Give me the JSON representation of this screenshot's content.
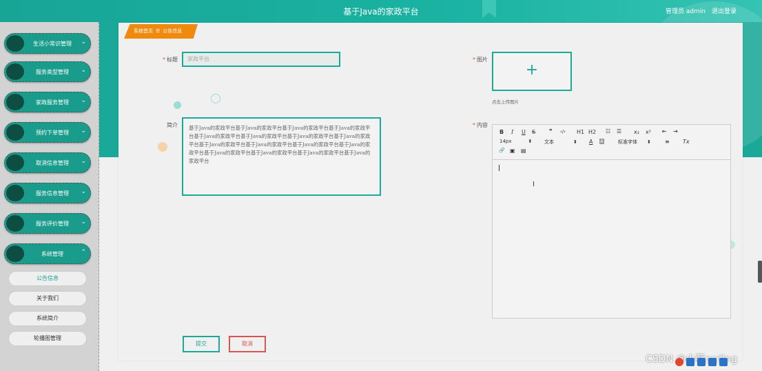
{
  "header": {
    "app_title": "基于Java的家政平台",
    "user_text": "管理员 admin",
    "logout_label": "退出登录"
  },
  "sidebar": {
    "items": [
      {
        "label": "生活小常识管理"
      },
      {
        "label": "服务类型管理"
      },
      {
        "label": "家政服务管理"
      },
      {
        "label": "预约下单管理"
      },
      {
        "label": "取消信息管理"
      },
      {
        "label": "服务信息管理"
      },
      {
        "label": "服务评价管理"
      },
      {
        "label": "系统管理"
      }
    ],
    "sub_items": [
      {
        "label": "公告信息"
      },
      {
        "label": "关于我们"
      },
      {
        "label": "系统简介"
      },
      {
        "label": "轮播图管理"
      }
    ]
  },
  "breadcrumb": {
    "home": "系统首页",
    "separator": "☰",
    "current": "公告信息"
  },
  "form": {
    "title_label": "标题",
    "title_value": "家政平台",
    "intro_label": "简介",
    "intro_value": "基于Java的家政平台基于Java的家政平台基于Java的家政平台基于Java的家政平台基于Java的家政平台基于Java的家政平台基于Java的家政平台基于Java的家政平台基于Java的家政平台基于Java的家政平台基于Java的家政平台基于Java的家政平台基于Java的家政平台基于Java的家政平台基于Java的家政平台基于Java的家政平台",
    "image_label": "图片",
    "upload_hint": "点击上传图片",
    "content_label": "内容",
    "required_mark": "*"
  },
  "editor_toolbar": {
    "bold": "B",
    "italic": "I",
    "underline": "U",
    "strike": "S",
    "quote": "❞",
    "code": "‹/›",
    "h1": "H1",
    "h2": "H2",
    "ordered_list": "☷",
    "bullet_list": "☰",
    "subscript": "x₂",
    "superscript": "x²",
    "indent_left": "⇤",
    "indent_right": "⇥",
    "size": "14px",
    "text_type": "文本",
    "font_color": "A",
    "bg_color": "A",
    "font_family": "标准字体",
    "align": "≡",
    "clear_format": "Tx",
    "link": "🔗",
    "image": "▣",
    "video": "▤"
  },
  "buttons": {
    "submit": "提交",
    "cancel": "取消"
  },
  "watermark": "CSDN @小蔡coding",
  "colors": {
    "primary": "#1aa898",
    "breadcrumb": "#f08a0c",
    "danger": "#d9534f",
    "sidebar_dot": "#0d4d42"
  }
}
